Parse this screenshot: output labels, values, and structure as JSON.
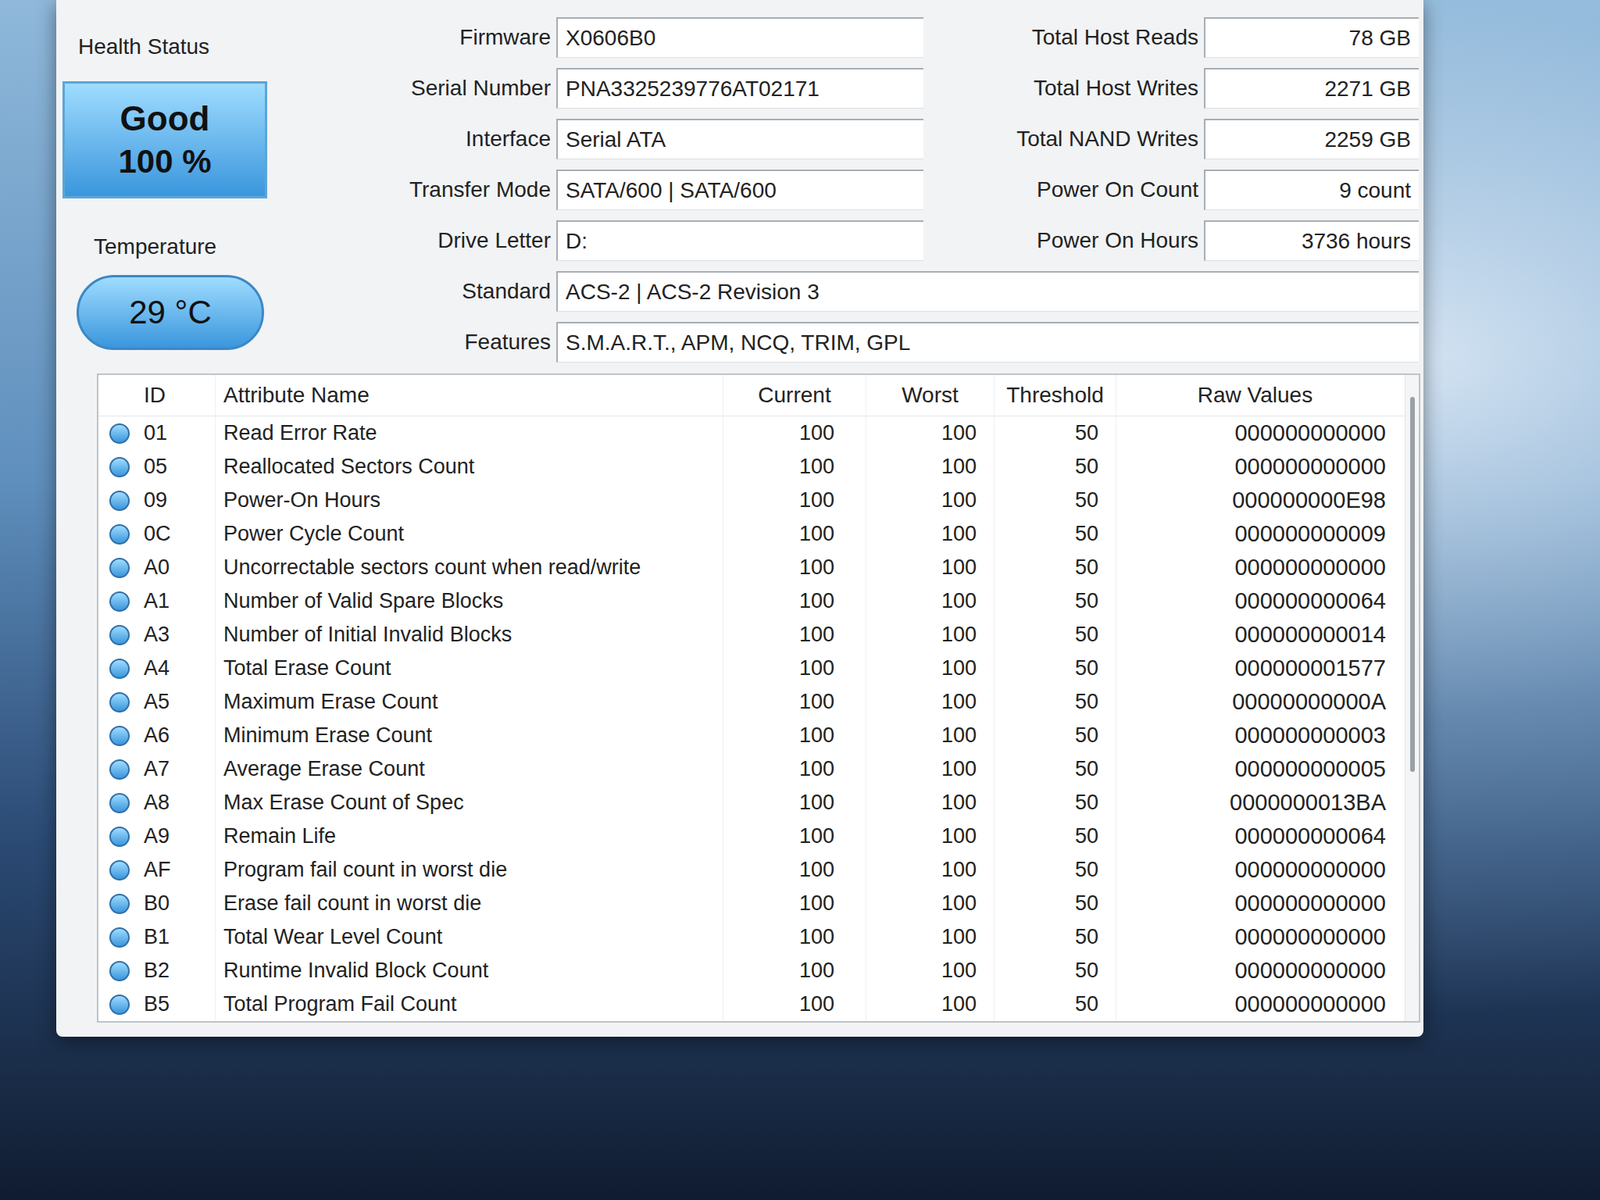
{
  "health": {
    "label": "Health Status",
    "status": "Good",
    "percent": "100 %",
    "state": "good"
  },
  "temperature": {
    "label": "Temperature",
    "value": "29 °C",
    "state": "good"
  },
  "info_left": [
    {
      "label": "Firmware",
      "value": "X0606B0"
    },
    {
      "label": "Serial Number",
      "value": "PNA3325239776AT02171"
    },
    {
      "label": "Interface",
      "value": "Serial ATA"
    },
    {
      "label": "Transfer Mode",
      "value": "SATA/600 | SATA/600"
    },
    {
      "label": "Drive Letter",
      "value": "D:"
    }
  ],
  "info_right": [
    {
      "label": "Total Host Reads",
      "value": "78 GB"
    },
    {
      "label": "Total Host Writes",
      "value": "2271 GB"
    },
    {
      "label": "Total NAND Writes",
      "value": "2259 GB"
    },
    {
      "label": "Power On Count",
      "value": "9 count"
    },
    {
      "label": "Power On Hours",
      "value": "3736 hours"
    }
  ],
  "info_wide": [
    {
      "label": "Standard",
      "value": "ACS-2 | ACS-2 Revision 3"
    },
    {
      "label": "Features",
      "value": "S.M.A.R.T., APM, NCQ, TRIM, GPL"
    }
  ],
  "table": {
    "columns": [
      "ID",
      "Attribute Name",
      "Current",
      "Worst",
      "Threshold",
      "Raw Values"
    ],
    "rows": [
      {
        "id": "01",
        "name": "Read Error Rate",
        "current": "100",
        "worst": "100",
        "threshold": "50",
        "raw": "000000000000",
        "status": "good"
      },
      {
        "id": "05",
        "name": "Reallocated Sectors Count",
        "current": "100",
        "worst": "100",
        "threshold": "50",
        "raw": "000000000000",
        "status": "good"
      },
      {
        "id": "09",
        "name": "Power-On Hours",
        "current": "100",
        "worst": "100",
        "threshold": "50",
        "raw": "000000000E98",
        "status": "good"
      },
      {
        "id": "0C",
        "name": "Power Cycle Count",
        "current": "100",
        "worst": "100",
        "threshold": "50",
        "raw": "000000000009",
        "status": "good"
      },
      {
        "id": "A0",
        "name": "Uncorrectable sectors count when read/write",
        "current": "100",
        "worst": "100",
        "threshold": "50",
        "raw": "000000000000",
        "status": "good"
      },
      {
        "id": "A1",
        "name": "Number of Valid Spare Blocks",
        "current": "100",
        "worst": "100",
        "threshold": "50",
        "raw": "000000000064",
        "status": "good"
      },
      {
        "id": "A3",
        "name": "Number of Initial Invalid Blocks",
        "current": "100",
        "worst": "100",
        "threshold": "50",
        "raw": "000000000014",
        "status": "good"
      },
      {
        "id": "A4",
        "name": "Total Erase Count",
        "current": "100",
        "worst": "100",
        "threshold": "50",
        "raw": "000000001577",
        "status": "good"
      },
      {
        "id": "A5",
        "name": "Maximum Erase Count",
        "current": "100",
        "worst": "100",
        "threshold": "50",
        "raw": "00000000000A",
        "status": "good"
      },
      {
        "id": "A6",
        "name": "Minimum Erase Count",
        "current": "100",
        "worst": "100",
        "threshold": "50",
        "raw": "000000000003",
        "status": "good"
      },
      {
        "id": "A7",
        "name": "Average Erase Count",
        "current": "100",
        "worst": "100",
        "threshold": "50",
        "raw": "000000000005",
        "status": "good"
      },
      {
        "id": "A8",
        "name": "Max Erase Count of Spec",
        "current": "100",
        "worst": "100",
        "threshold": "50",
        "raw": "0000000013BA",
        "status": "good"
      },
      {
        "id": "A9",
        "name": "Remain Life",
        "current": "100",
        "worst": "100",
        "threshold": "50",
        "raw": "000000000064",
        "status": "good"
      },
      {
        "id": "AF",
        "name": "Program fail count in worst die",
        "current": "100",
        "worst": "100",
        "threshold": "50",
        "raw": "000000000000",
        "status": "good"
      },
      {
        "id": "B0",
        "name": "Erase fail count in worst die",
        "current": "100",
        "worst": "100",
        "threshold": "50",
        "raw": "000000000000",
        "status": "good"
      },
      {
        "id": "B1",
        "name": "Total Wear Level Count",
        "current": "100",
        "worst": "100",
        "threshold": "50",
        "raw": "000000000000",
        "status": "good"
      },
      {
        "id": "B2",
        "name": "Runtime Invalid Block Count",
        "current": "100",
        "worst": "100",
        "threshold": "50",
        "raw": "000000000000",
        "status": "good"
      },
      {
        "id": "B5",
        "name": "Total Program Fail Count",
        "current": "100",
        "worst": "100",
        "threshold": "50",
        "raw": "000000000000",
        "status": "good"
      }
    ]
  }
}
